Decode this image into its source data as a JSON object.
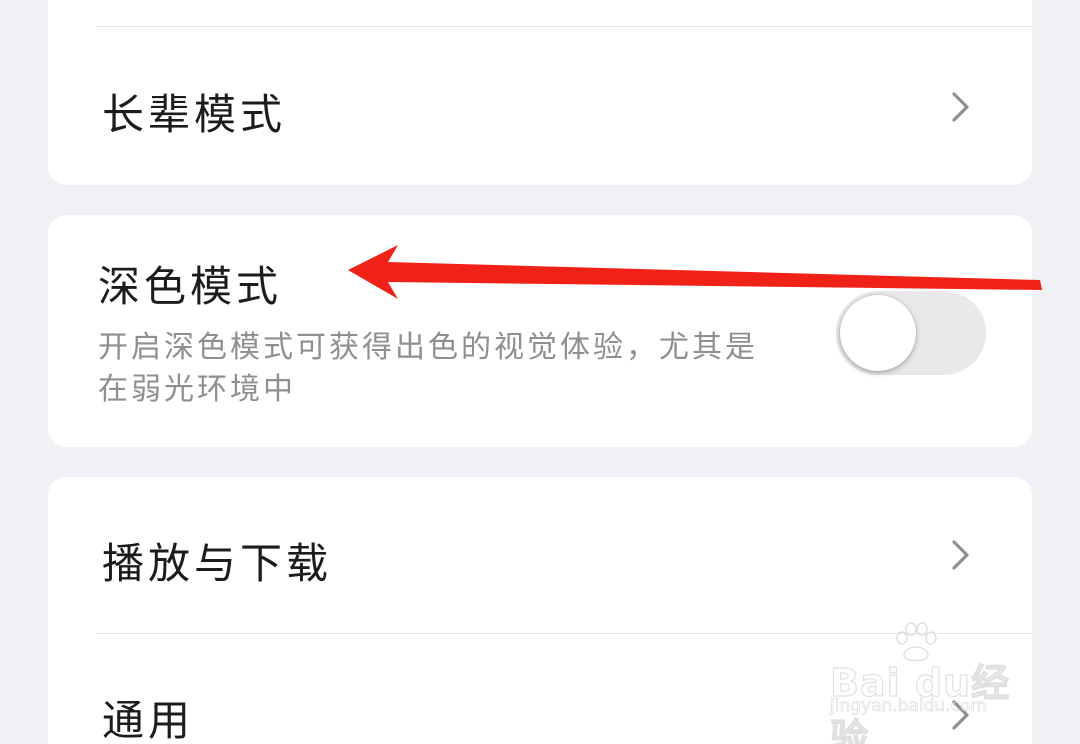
{
  "settings": {
    "elder_mode": {
      "label": "长辈模式"
    },
    "dark_mode": {
      "label": "深色模式",
      "description": "开启深色模式可获得出色的视觉体验，尤其是在弱光环境中",
      "enabled": false
    },
    "play_download": {
      "label": "播放与下载"
    },
    "general": {
      "label": "通用"
    }
  },
  "annotation": {
    "arrow_color": "#f02218"
  },
  "watermark": {
    "brand": "Bai du经验",
    "url": "jingyan.baidu.com"
  },
  "colors": {
    "background": "#eff1f5",
    "card": "#ffffff",
    "text_primary": "#1c1c1e",
    "text_secondary": "#8e8e93",
    "toggle_off": "#e9e9ec"
  }
}
